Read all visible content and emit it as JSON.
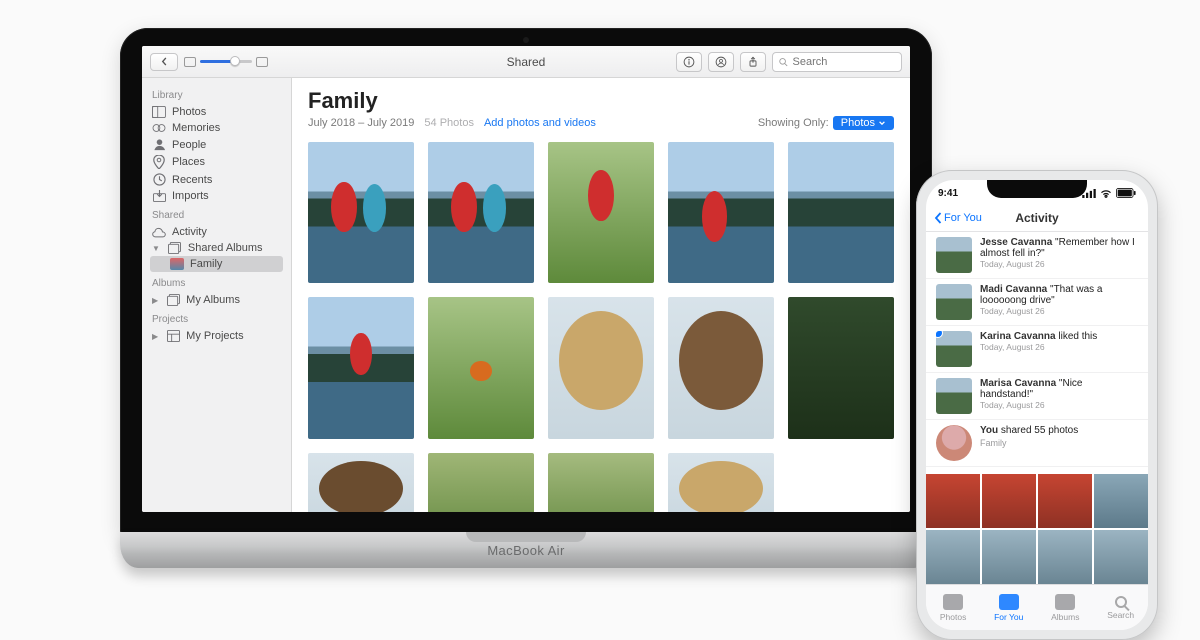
{
  "macbook_label": "MacBook Air",
  "titlebar": {
    "title": "Shared",
    "search_placeholder": "Search"
  },
  "sidebar": {
    "library_label": "Library",
    "library": [
      {
        "label": "Photos",
        "icon": "photos"
      },
      {
        "label": "Memories",
        "icon": "memories"
      },
      {
        "label": "People",
        "icon": "people"
      },
      {
        "label": "Places",
        "icon": "places"
      },
      {
        "label": "Recents",
        "icon": "recents"
      },
      {
        "label": "Imports",
        "icon": "imports"
      }
    ],
    "shared_label": "Shared",
    "shared": [
      {
        "label": "Activity",
        "icon": "cloud"
      },
      {
        "label": "Shared Albums",
        "icon": "albums",
        "children": [
          {
            "label": "Family",
            "selected": true
          }
        ]
      }
    ],
    "albums_label": "Albums",
    "albums": [
      {
        "label": "My Albums",
        "icon": "albums"
      }
    ],
    "projects_label": "Projects",
    "projects": [
      {
        "label": "My Projects",
        "icon": "projects"
      }
    ]
  },
  "album": {
    "title": "Family",
    "date_range": "July 2018 – July 2019",
    "count": "54 Photos",
    "add_link": "Add photos and videos",
    "showing_label": "Showing Only:",
    "showing_pill": "Photos"
  },
  "iphone": {
    "time": "9:41",
    "back": "For You",
    "title": "Activity",
    "items": [
      {
        "name": "Jesse Cavanna",
        "body": " \"Remember how I almost fell in?\"",
        "date": "Today, August 26"
      },
      {
        "name": "Madi Cavanna",
        "body": " \"That was a loooooong drive\"",
        "date": "Today, August 26"
      },
      {
        "name": "Karina Cavanna",
        "body": " liked this",
        "date": "Today, August 26",
        "dot": true
      },
      {
        "name": "Marisa Cavanna",
        "body": " \"Nice handstand!\"",
        "date": "Today, August 26"
      },
      {
        "name": "You",
        "body": " shared 55 photos",
        "sub": "Family",
        "avatar": true
      }
    ],
    "tabs": [
      {
        "label": "Photos"
      },
      {
        "label": "For You",
        "active": true
      },
      {
        "label": "Albums"
      },
      {
        "label": "Search",
        "mag": true
      }
    ]
  }
}
